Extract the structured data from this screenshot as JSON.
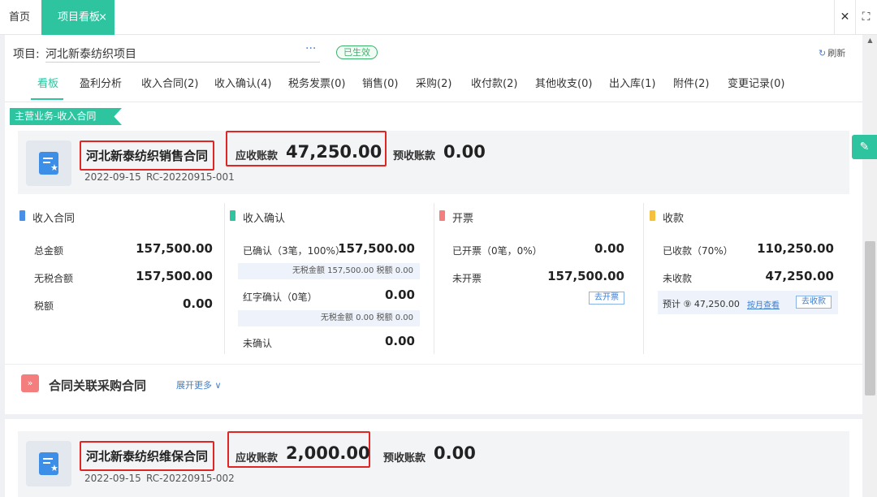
{
  "tabs": {
    "home": "首页",
    "active": "项目看板",
    "close": "×"
  },
  "window_controls": {
    "close": "✕",
    "fullscreen": "⛶"
  },
  "project": {
    "label": "项目:",
    "name": "河北新泰纺织项目",
    "more": "···",
    "status": "已生效",
    "refresh": "刷新"
  },
  "subtabs": [
    "看板",
    "盈利分析",
    "收入合同(2)",
    "收入确认(4)",
    "税务发票(0)",
    "销售(0)",
    "采购(2)",
    "收付款(2)",
    "其他收支(0)",
    "出入库(1)",
    "附件(2)",
    "变更记录(0)"
  ],
  "section_ribbon": "主营业务-收入合同",
  "contract1": {
    "title": "河北新泰纺织销售合同",
    "receivable_label": "应收账款",
    "receivable_value": "47,250.00",
    "prepaid_label": "预收账款",
    "prepaid_value": "0.00",
    "date": "2022-09-15",
    "code": "RC-20220915-001"
  },
  "col_contract": {
    "title": "收入合同",
    "total_label": "总金额",
    "total_value": "157,500.00",
    "notax_label": "无税合额",
    "notax_value": "157,500.00",
    "tax_label": "税额",
    "tax_value": "0.00"
  },
  "col_confirm": {
    "title": "收入确认",
    "confirmed_label": "已确认（3笔，100%）",
    "confirmed_value": "157,500.00",
    "confirmed_note": "无税金额 157,500.00 税额 0.00",
    "red_label": "红字确认（0笔）",
    "red_value": "0.00",
    "red_note": "无税金额 0.00 税额 0.00",
    "unconfirmed_label": "未确认",
    "unconfirmed_value": "0.00"
  },
  "col_invoice": {
    "title": "开票",
    "invoiced_label": "已开票（0笔，0%）",
    "invoiced_value": "0.00",
    "uninvoiced_label": "未开票",
    "uninvoiced_value": "157,500.00",
    "button": "去开票"
  },
  "col_receipt": {
    "title": "收款",
    "received_label": "已收款（70%）",
    "received_value": "110,250.00",
    "unreceived_label": "未收款",
    "unreceived_value": "47,250.00",
    "plan_text": "预计 ⑨ 47,250.00",
    "plan_link": "按月查看",
    "button": "去收款"
  },
  "related_purchase": {
    "icon": "»",
    "title": "合同关联采购合同",
    "more": "展开更多 ∨"
  },
  "contract2": {
    "title": "河北新泰纺织维保合同",
    "receivable_label": "应收账款",
    "receivable_value": "2,000.00",
    "prepaid_label": "预收账款",
    "prepaid_value": "0.00",
    "date": "2022-09-15",
    "code": "RC-20220915-002"
  },
  "colors": {
    "accent": "#2ec4a0",
    "highlight_border": "#e02525",
    "bar_contract": "#4a8fe6",
    "bar_confirm": "#2ec4a0",
    "bar_invoice": "#f47d7d",
    "bar_receipt": "#f5c03d"
  }
}
